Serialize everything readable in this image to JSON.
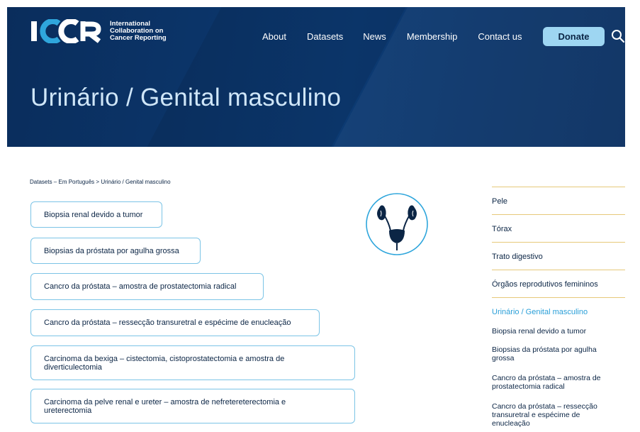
{
  "header": {
    "logo": {
      "wordmark": "ICCR",
      "lines": [
        "International",
        "Collaboration on",
        "Cancer Reporting"
      ]
    },
    "nav": [
      "About",
      "Datasets",
      "News",
      "Membership",
      "Contact us"
    ],
    "donate_label": "Donate",
    "page_title": "Urinário / Genital masculino"
  },
  "breadcrumb": {
    "items": [
      "Datasets",
      "Em Português",
      "Urinário / Genital masculino"
    ],
    "sep1": " – ",
    "sep2": " > "
  },
  "datasets": [
    "Biopsia renal devido a tumor",
    "Biopsias da próstata por agulha grossa",
    "Cancro da próstata – amostra de prostatectomia radical",
    "Cancro da próstata – ressecção transuretral e espécime de enucleação",
    "Carcinoma da bexiga – cistectomia, cistoprostatectomia e amostra de diverticulectomia",
    "Carcinoma da pelve renal e ureter – amostra de nefretereterectomia e ureterectomia"
  ],
  "sidebar": {
    "categories": [
      "Pele",
      "Tórax",
      "Trato digestivo",
      "Órgãos reprodutivos femininos"
    ],
    "active": "Urinário / Genital masculino",
    "subitems": [
      "Biopsia renal devido a tumor",
      "Biopsias da próstata por agulha grossa",
      "Cancro da próstata – amostra de prostatectomia radical",
      "Cancro da próstata – ressecção transuretral e espécime de enucleação"
    ]
  },
  "colors": {
    "hero": "#0c3a72",
    "accent": "#9ed6f2",
    "link_active": "#2a9fd8",
    "divider": "#e6c97a",
    "pill_border": "#7cc4e6"
  },
  "icons": [
    "search-icon",
    "urinary-system-icon"
  ]
}
